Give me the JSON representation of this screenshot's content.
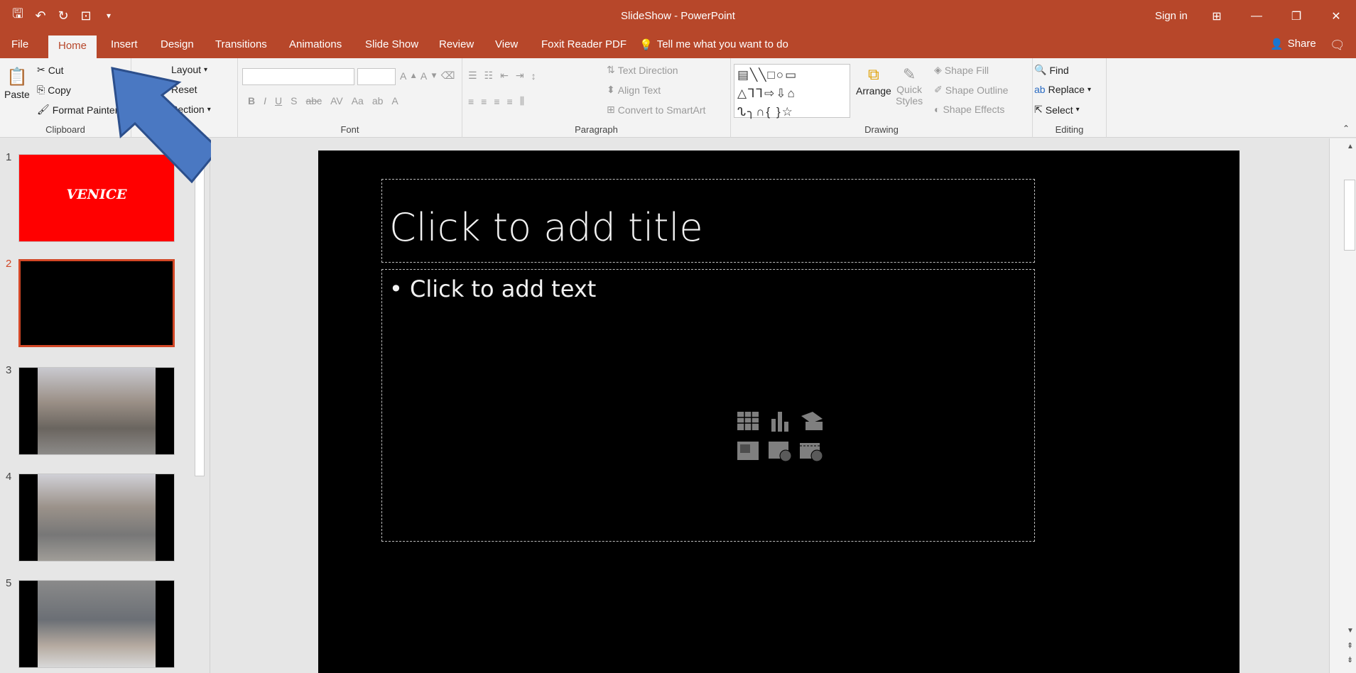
{
  "window": {
    "title": "SlideShow - PowerPoint",
    "sign_in": "Sign in"
  },
  "tabs": [
    "File",
    "Home",
    "Insert",
    "Design",
    "Transitions",
    "Animations",
    "Slide Show",
    "Review",
    "View",
    "Foxit Reader PDF"
  ],
  "active_tab": "Home",
  "tell_me": "Tell me what you want to do",
  "share": "Share",
  "ribbon": {
    "clipboard": {
      "label": "Clipboard",
      "paste": "Paste",
      "cut": "Cut",
      "copy": "Copy",
      "format_painter": "Format Painter"
    },
    "slides": {
      "layout": "Layout",
      "reset": "Reset",
      "section": "Section"
    },
    "font": {
      "label": "Font",
      "bold": "B",
      "italic": "I",
      "underline": "U",
      "shadow": "S",
      "strike": "abc",
      "spacing": "AV",
      "case": "Aa"
    },
    "paragraph": {
      "label": "Paragraph",
      "text_direction": "Text Direction",
      "align_text": "Align Text",
      "convert_smartart": "Convert to SmartArt"
    },
    "drawing": {
      "label": "Drawing",
      "arrange": "Arrange",
      "quick": "Quick",
      "styles": "Styles",
      "shape_fill": "Shape Fill",
      "shape_outline": "Shape Outline",
      "shape_effects": "Shape Effects"
    },
    "editing": {
      "label": "Editing",
      "find": "Find",
      "replace": "Replace",
      "select": "Select"
    }
  },
  "thumbnails": [
    {
      "num": "1",
      "caption": "VENICE"
    },
    {
      "num": "2"
    },
    {
      "num": "3"
    },
    {
      "num": "4"
    },
    {
      "num": "5"
    }
  ],
  "slide": {
    "title_placeholder": "Click to add title",
    "body_placeholder": "• Click to add text"
  },
  "colors": {
    "accent": "#b7472a",
    "selection": "#d24726"
  }
}
